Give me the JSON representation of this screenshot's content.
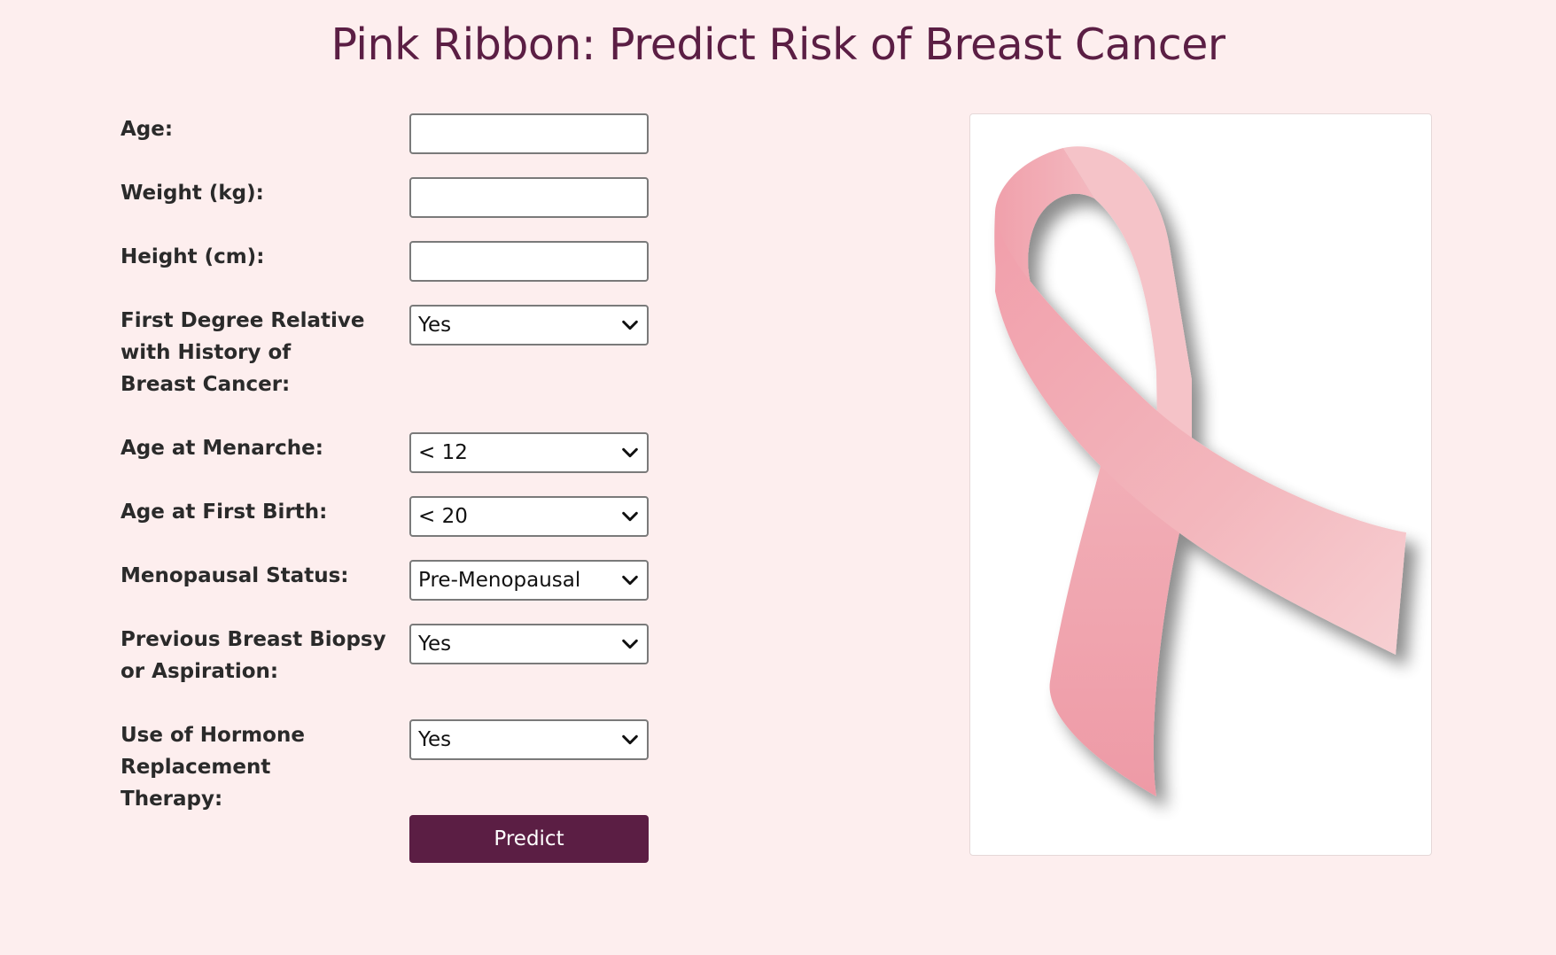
{
  "header": {
    "title": "Pink Ribbon: Predict Risk of Breast Cancer"
  },
  "form": {
    "age": {
      "label": "Age:",
      "value": ""
    },
    "weight": {
      "label": "Weight (kg):",
      "value": ""
    },
    "height": {
      "label": "Height (cm):",
      "value": ""
    },
    "first_degree_relative": {
      "label": "First Degree Relative with History of Breast Cancer:",
      "selected": "Yes"
    },
    "age_at_menarche": {
      "label": "Age at Menarche:",
      "selected": "< 12"
    },
    "age_at_first_birth": {
      "label": "Age at First Birth:",
      "selected": "< 20"
    },
    "menopausal_status": {
      "label": "Menopausal Status:",
      "selected": "Pre-Menopausal"
    },
    "previous_biopsy": {
      "label": "Previous Breast Biopsy or Aspiration:",
      "selected": "Yes"
    },
    "hormone_therapy": {
      "label": "Use of Hormone Replacement Therapy:",
      "selected": "Yes"
    },
    "submit_label": "Predict"
  },
  "image": {
    "icon": "pink-ribbon-icon"
  },
  "colors": {
    "background": "#fdeeee",
    "accent": "#5b1e44",
    "ribbon": "#f0a5ae"
  }
}
